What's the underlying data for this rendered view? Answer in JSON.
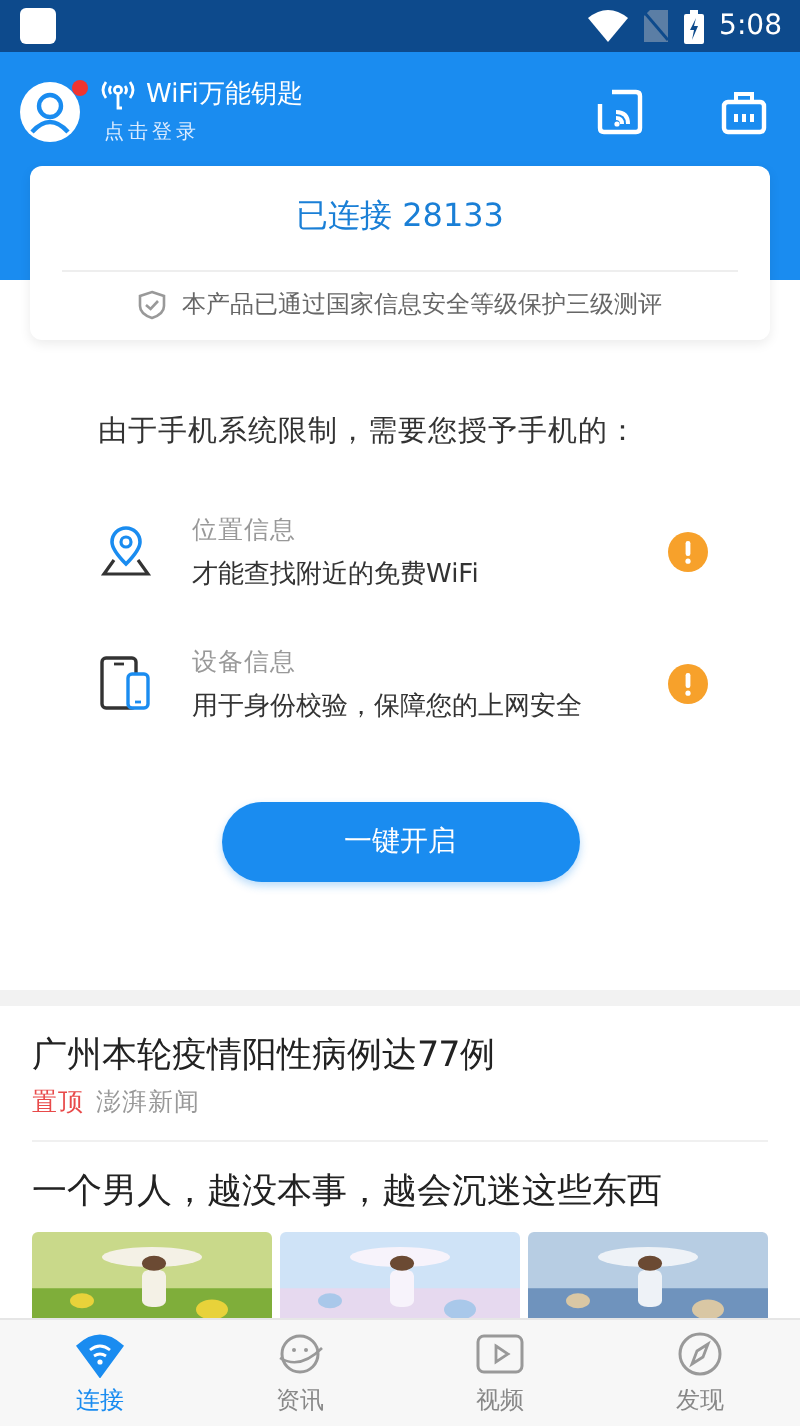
{
  "status_bar": {
    "time": "5:08"
  },
  "header": {
    "app_name": "WiFi万能钥匙",
    "login_hint": "点击登录",
    "has_notification": true
  },
  "connect_card": {
    "title": "已连接 28133",
    "security_note": "本产品已通过国家信息安全等级保护三级测评"
  },
  "permissions": {
    "intro": "由于手机系统限制，需要您授予手机的：",
    "items": [
      {
        "kind": "location",
        "title": "位置信息",
        "description": "才能查找附近的免费WiFi",
        "warning": true
      },
      {
        "kind": "device",
        "title": "设备信息",
        "description": "用于身份校验，保障您的上网安全",
        "warning": true
      }
    ],
    "button": "一键开启"
  },
  "news": [
    {
      "title": "广州本轮疫情阳性病例达77例",
      "tag": "置顶",
      "source": "澎湃新闻"
    },
    {
      "title": "一个男人，越没本事，越会沉迷这些东西"
    }
  ],
  "tabs": [
    {
      "label": "连接",
      "selected": true
    },
    {
      "label": "资讯",
      "selected": false
    },
    {
      "label": "视频",
      "selected": false
    },
    {
      "label": "发现",
      "selected": false
    }
  ]
}
